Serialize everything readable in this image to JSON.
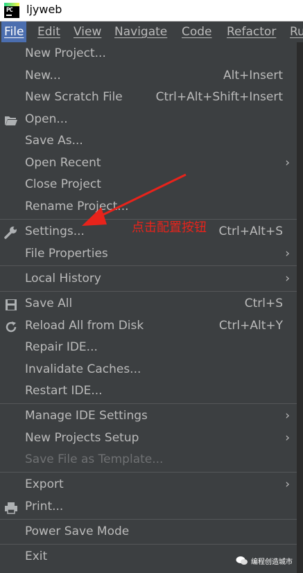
{
  "window": {
    "title": "ljyweb"
  },
  "menubar": {
    "items": [
      "File",
      "Edit",
      "View",
      "Navigate",
      "Code",
      "Refactor",
      "Ru"
    ]
  },
  "file_menu": [
    {
      "label": "New Project...",
      "shortcut": "",
      "submenu": false
    },
    {
      "label": "New...",
      "shortcut": "Alt+Insert",
      "submenu": false
    },
    {
      "label": "New Scratch File",
      "shortcut": "Ctrl+Alt+Shift+Insert",
      "submenu": false
    },
    {
      "label": "Open...",
      "shortcut": "",
      "submenu": false,
      "icon": "folder-open-icon"
    },
    {
      "label": "Save As...",
      "shortcut": "",
      "submenu": false
    },
    {
      "label": "Open Recent",
      "shortcut": "",
      "submenu": true
    },
    {
      "label": "Close Project",
      "shortcut": "",
      "submenu": false
    },
    {
      "label": "Rename Project...",
      "shortcut": "",
      "submenu": false
    },
    {
      "label": "Settings...",
      "shortcut": "Ctrl+Alt+S",
      "submenu": false,
      "icon": "wrench-icon"
    },
    {
      "label": "File Properties",
      "shortcut": "",
      "submenu": true
    },
    {
      "label": "Local History",
      "shortcut": "",
      "submenu": true
    },
    {
      "label": "Save All",
      "shortcut": "Ctrl+S",
      "submenu": false,
      "icon": "save-icon"
    },
    {
      "label": "Reload All from Disk",
      "shortcut": "Ctrl+Alt+Y",
      "submenu": false,
      "icon": "reload-icon"
    },
    {
      "label": "Repair IDE...",
      "shortcut": "",
      "submenu": false
    },
    {
      "label": "Invalidate Caches...",
      "shortcut": "",
      "submenu": false
    },
    {
      "label": "Restart IDE...",
      "shortcut": "",
      "submenu": false
    },
    {
      "label": "Manage IDE Settings",
      "shortcut": "",
      "submenu": true
    },
    {
      "label": "New Projects Setup",
      "shortcut": "",
      "submenu": true
    },
    {
      "label": "Save File as Template...",
      "shortcut": "",
      "submenu": false,
      "disabled": true
    },
    {
      "label": "Export",
      "shortcut": "",
      "submenu": true
    },
    {
      "label": "Print...",
      "shortcut": "",
      "submenu": false,
      "icon": "printer-icon"
    },
    {
      "label": "Power Save Mode",
      "shortcut": "",
      "submenu": false
    },
    {
      "label": "Exit",
      "shortcut": "",
      "submenu": false
    }
  ],
  "annotation": {
    "text": "点击配置按钮",
    "color": "#e8231b"
  },
  "watermark": {
    "text": "编程创造城市"
  },
  "colors": {
    "menu_bg": "#3c3f41",
    "text": "#bbbbbb",
    "active": "#4b6eaf",
    "disabled": "#6f7173"
  }
}
